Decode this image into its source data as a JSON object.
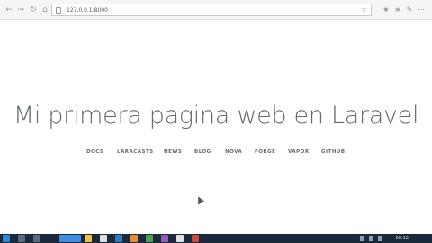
{
  "browser": {
    "url": "127.0.0.1:8000",
    "back_icon": "back-arrow-icon",
    "forward_icon": "forward-arrow-icon",
    "refresh_icon": "refresh-icon",
    "home_icon": "home-icon"
  },
  "page": {
    "title": "Mi primera pagina web en Laravel",
    "links": [
      "DOCS",
      "LARACASTS",
      "NEWS",
      "BLOG",
      "NOVA",
      "FORGE",
      "VAPOR",
      "GITHUB"
    ]
  },
  "taskbar": {
    "clock": "00:12"
  }
}
